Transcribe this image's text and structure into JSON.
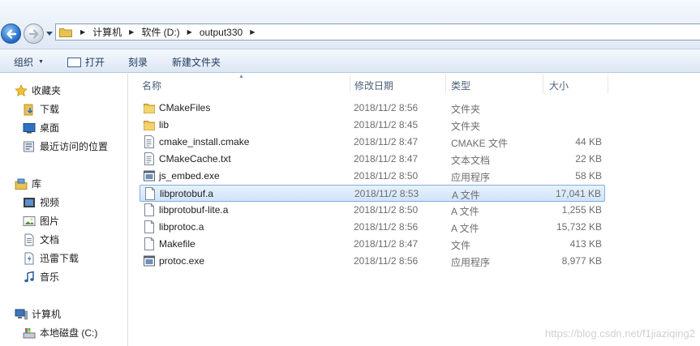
{
  "address": {
    "breadcrumbs": [
      "计算机",
      "软件 (D:)",
      "output330"
    ]
  },
  "toolbar": {
    "organize_label": "组织",
    "open_label": "打开",
    "burn_label": "刻录",
    "new_folder_label": "新建文件夹"
  },
  "navpane": {
    "favorites": {
      "label": "收藏夹",
      "items": [
        "下载",
        "桌面",
        "最近访问的位置"
      ]
    },
    "libraries": {
      "label": "库",
      "items": [
        "视频",
        "图片",
        "文档",
        "迅雷下载",
        "音乐"
      ]
    },
    "computer": {
      "label": "计算机",
      "items": [
        "本地磁盘 (C:)"
      ]
    }
  },
  "columns": {
    "name": "名称",
    "date": "修改日期",
    "type": "类型",
    "size": "大小"
  },
  "files": [
    {
      "name": "CMakeFiles",
      "date": "2018/11/2 8:56",
      "type": "文件夹",
      "size": "",
      "icon": "folder-icon"
    },
    {
      "name": "lib",
      "date": "2018/11/2 8:45",
      "type": "文件夹",
      "size": "",
      "icon": "folder-icon"
    },
    {
      "name": "cmake_install.cmake",
      "date": "2018/11/2 8:47",
      "type": "CMAKE 文件",
      "size": "44 KB",
      "icon": "text-file-icon"
    },
    {
      "name": "CMakeCache.txt",
      "date": "2018/11/2 8:47",
      "type": "文本文档",
      "size": "22 KB",
      "icon": "text-file-icon"
    },
    {
      "name": "js_embed.exe",
      "date": "2018/11/2 8:50",
      "type": "应用程序",
      "size": "58 KB",
      "icon": "exe-icon"
    },
    {
      "name": "libprotobuf.a",
      "date": "2018/11/2 8:53",
      "type": "A 文件",
      "size": "17,041 KB",
      "icon": "file-icon",
      "selected": true
    },
    {
      "name": "libprotobuf-lite.a",
      "date": "2018/11/2 8:50",
      "type": "A 文件",
      "size": "1,255 KB",
      "icon": "file-icon"
    },
    {
      "name": "libprotoc.a",
      "date": "2018/11/2 8:56",
      "type": "A 文件",
      "size": "15,732 KB",
      "icon": "file-icon"
    },
    {
      "name": "Makefile",
      "date": "2018/11/2 8:47",
      "type": "文件",
      "size": "413 KB",
      "icon": "file-icon"
    },
    {
      "name": "protoc.exe",
      "date": "2018/11/2 8:56",
      "type": "应用程序",
      "size": "8,977 KB",
      "icon": "exe-icon"
    }
  ],
  "watermark": "https://blog.csdn.net/f1jiaziqing2",
  "colors": {
    "folder": "#e8c252",
    "selection_border": "#84acdd",
    "link_text": "#1e395b"
  }
}
